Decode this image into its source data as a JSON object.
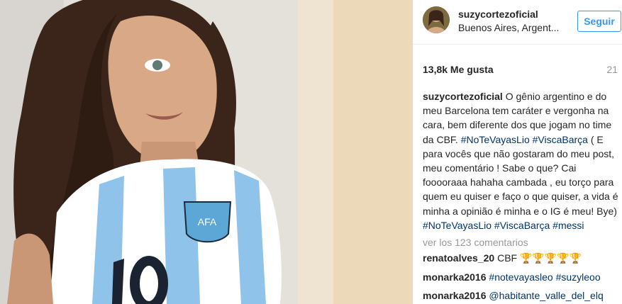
{
  "post": {
    "username": "suzycortezoficial",
    "location": "Buenos Aires, Argent...",
    "follow_label": "Seguir",
    "likes": "13,8k Me gusta",
    "time": "21",
    "caption": {
      "username": "suzycortezoficial",
      "text_1": " O gênio argentino e do meu Barcelona tem caráter e vergonha na cara, bem diferente dos que jogam no time da CBF. ",
      "tag_1": "#NoTeVayasLio",
      "space_1": " ",
      "tag_2": "#ViscaBarça",
      "text_2": " ( E para vocês que não gostaram do meu post, meu comentário ! Sabe o que? Cai fooooraaa hahaha cambada , eu torço para quem eu quiser e faço o que quiser, a vida é minha a opinião é minha e o IG é meu! Bye) ",
      "tag_3": "#NoTeVayasLio",
      "space_2": " ",
      "tag_4": "#ViscaBarça",
      "space_3": " ",
      "tag_5": "#messi"
    },
    "view_comments": "ver los 123 comentarios"
  },
  "comments": [
    {
      "user": "renatoalves_20",
      "text": " CBF 🏆🏆🏆🏆🏆"
    },
    {
      "user": "monarka2016",
      "text": "#notevayasleo #suzyleoo"
    },
    {
      "user": "monarka2016",
      "text": "@habitante_valle_del_elq"
    }
  ],
  "colors": {
    "accent": "#3897f0",
    "hashtag": "#003569",
    "muted": "#999999"
  }
}
